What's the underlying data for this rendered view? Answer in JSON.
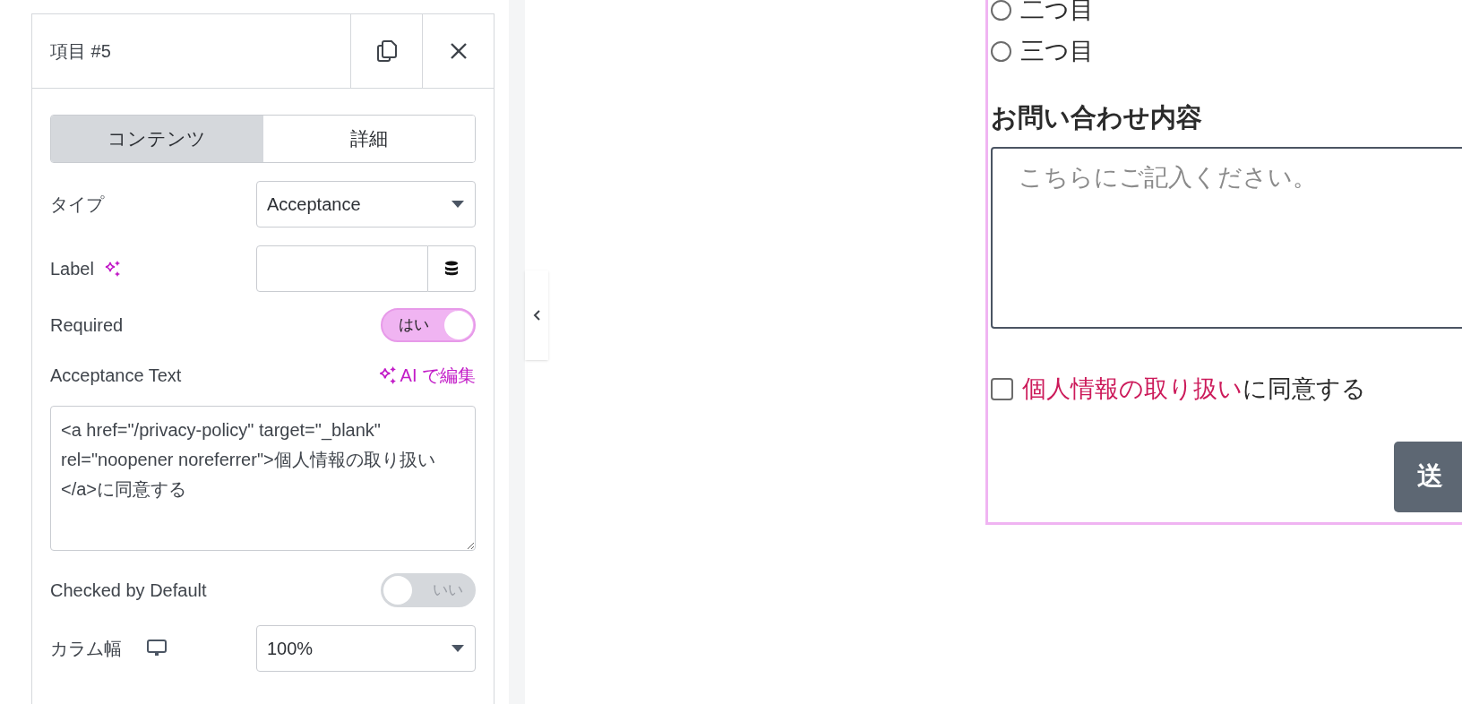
{
  "panel": {
    "title": "項目 #5",
    "tabs": [
      {
        "label": "コンテンツ",
        "selected": true
      },
      {
        "label": "詳細",
        "selected": false
      }
    ],
    "fields": [
      {
        "kind": "select",
        "label": "タイプ",
        "value": "Acceptance"
      },
      {
        "kind": "dynamic",
        "label": "Label",
        "ai": true
      },
      {
        "kind": "toggle",
        "label": "Required",
        "on": true,
        "state_text": "はい"
      },
      {
        "kind": "textarea",
        "label": "Acceptance Text",
        "action": "AI で編集",
        "value": "<a href=\"/privacy-policy\" target=\"_blank\" rel=\"noopener noreferrer\">個人情報の取り扱い</a>に同意する"
      },
      {
        "kind": "toggle",
        "label": "Checked by Default",
        "on": false,
        "state_text": "いい"
      },
      {
        "kind": "select",
        "label": "カラム幅",
        "device": true,
        "value": "100%"
      }
    ]
  },
  "preview": {
    "radios": [
      {
        "label": "二つ目",
        "selected": false
      },
      {
        "label": "三つ目",
        "selected": false
      }
    ],
    "message_label": "お問い合わせ内容",
    "message_placeholder": "こちらにご記入ください。",
    "acceptance": {
      "checked": false,
      "link": "個人情報の取り扱い",
      "text": "に同意する"
    },
    "submit": "送"
  }
}
